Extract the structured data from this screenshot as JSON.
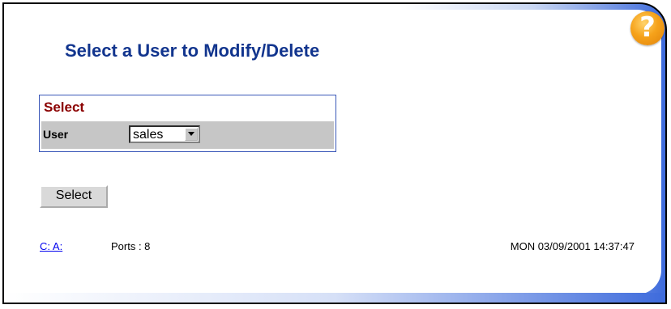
{
  "header": {
    "title": "Select a User to Modify/Delete",
    "help_icon": "question-icon"
  },
  "select_panel": {
    "heading": "Select",
    "user_label": "User",
    "user_value": "sales"
  },
  "actions": {
    "select_button_label": "Select"
  },
  "footer": {
    "link_text": "C: A:",
    "ports": "Ports : 8",
    "timestamp": "MON 03/09/2001 14:37:47"
  },
  "colors": {
    "title": "#12358e",
    "heading": "#8b0000",
    "help_icon": "#f6a21a",
    "accent_blue": "#3e6bdc"
  }
}
